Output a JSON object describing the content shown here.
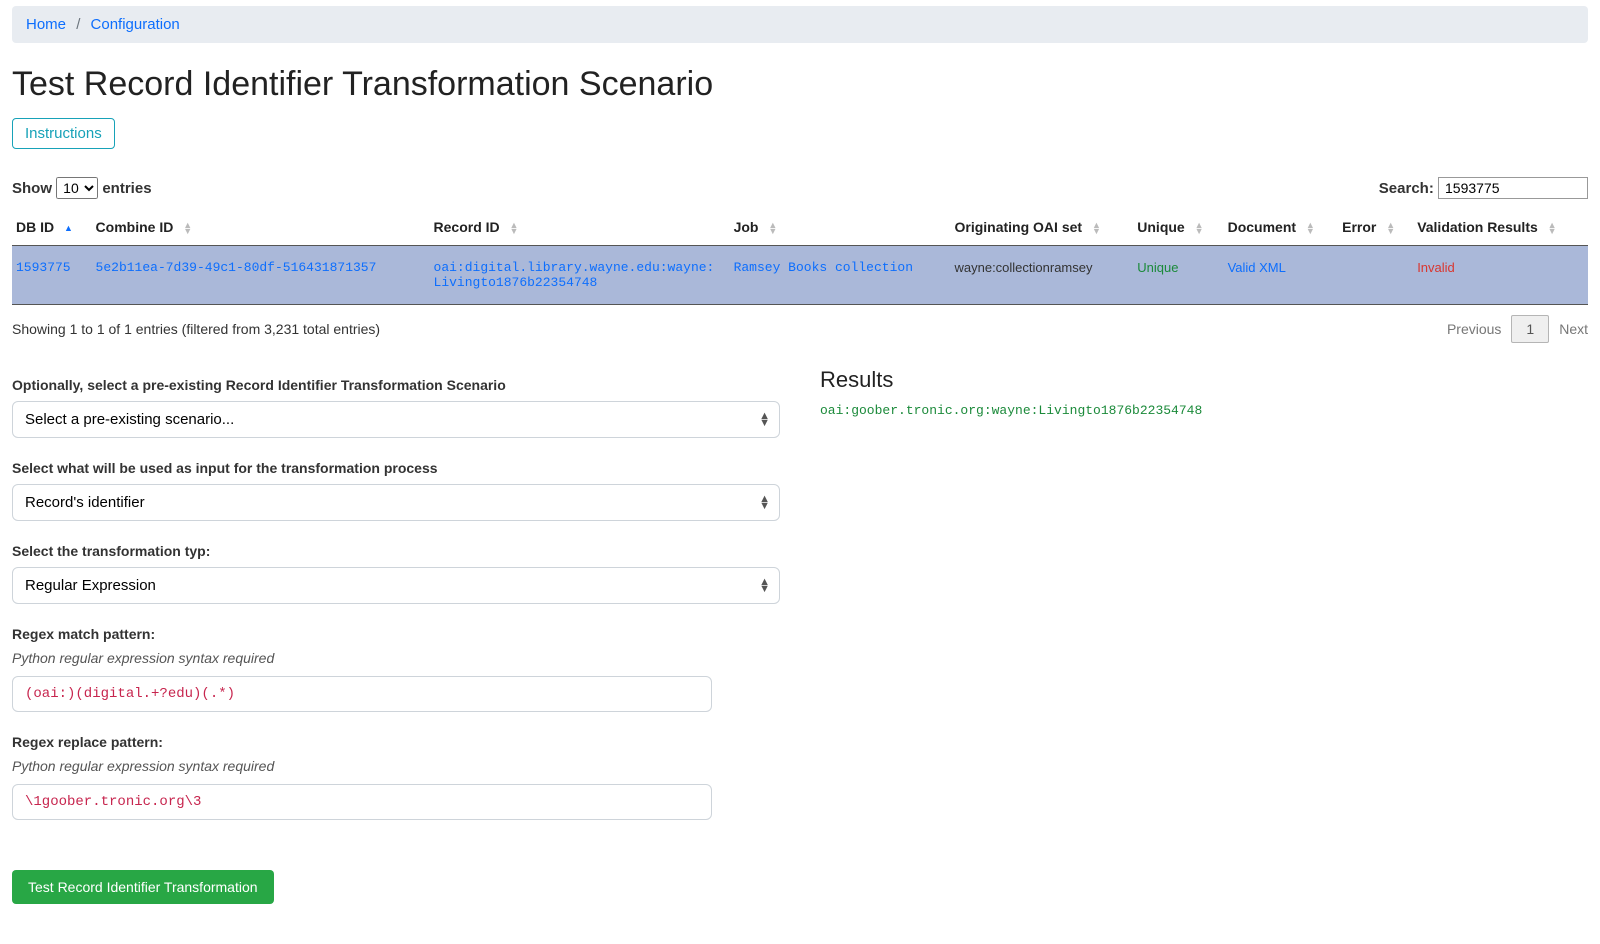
{
  "breadcrumb": {
    "home": "Home",
    "config": "Configuration"
  },
  "page_title": "Test Record Identifier Transformation Scenario",
  "instructions_label": "Instructions",
  "table_controls": {
    "show_prefix": "Show",
    "show_value": "10",
    "show_suffix": "entries",
    "search_label": "Search:",
    "search_value": "1593775"
  },
  "columns": {
    "db_id": "DB ID",
    "combine_id": "Combine ID",
    "record_id": "Record ID",
    "job": "Job",
    "oai_set": "Originating OAI set",
    "unique": "Unique",
    "document": "Document",
    "error": "Error",
    "validation": "Validation Results"
  },
  "row": {
    "db_id": "1593775",
    "combine_id": "5e2b11ea-7d39-49c1-80df-516431871357",
    "record_id": "oai:digital.library.wayne.edu:wayne:Livingto1876b22354748",
    "job": "Ramsey Books collection",
    "oai_set": "wayne:collectionramsey",
    "unique": "Unique",
    "document": "Valid XML",
    "error": "",
    "validation": "Invalid"
  },
  "table_info": "Showing 1 to 1 of 1 entries (filtered from 3,231 total entries)",
  "pager": {
    "prev": "Previous",
    "page": "1",
    "next": "Next"
  },
  "form": {
    "scenario_label": "Optionally, select a pre-existing Record Identifier Transformation Scenario",
    "scenario_value": "Select a pre-existing scenario...",
    "input_label": "Select what will be used as input for the transformation process",
    "input_value": "Record's identifier",
    "type_label": "Select the transformation typ:",
    "type_value": "Regular Expression",
    "match_label": "Regex match pattern:",
    "match_hint": "Python regular expression syntax required",
    "match_value": "(oai:)(digital.+?edu)(.*)",
    "replace_label": "Regex replace pattern:",
    "replace_hint": "Python regular expression syntax required",
    "replace_value": "\\1goober.tronic.org\\3",
    "submit_label": "Test Record Identifier Transformation"
  },
  "results": {
    "title": "Results",
    "value": "oai:goober.tronic.org:wayne:Livingto1876b22354748"
  }
}
